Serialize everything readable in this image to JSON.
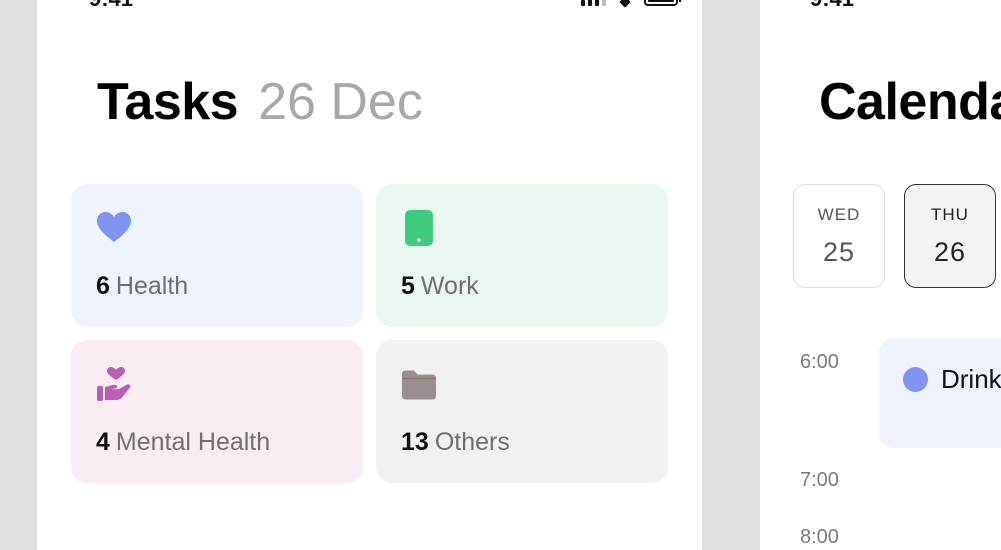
{
  "tasks_screen": {
    "status_time": "9:41",
    "title": "Tasks",
    "date": "26 Dec",
    "categories": [
      {
        "count": "6",
        "label": "Health",
        "icon": "heart-icon",
        "color": "#7f93f2"
      },
      {
        "count": "5",
        "label": "Work",
        "icon": "tablet-icon",
        "color": "#3ecb7f"
      },
      {
        "count": "4",
        "label": "Mental Health",
        "icon": "hand-heart-icon",
        "color": "#bc5fb4"
      },
      {
        "count": "13",
        "label": "Others",
        "icon": "folder-icon",
        "color": "#9a8f8e"
      }
    ]
  },
  "calendar_screen": {
    "status_time": "9:41",
    "title": "Calendar",
    "days": [
      {
        "name": "WED",
        "num": "25",
        "selected": false
      },
      {
        "name": "THU",
        "num": "26",
        "selected": true
      }
    ],
    "times": [
      "6:00",
      "7:00",
      "8:00"
    ],
    "event": {
      "title": "Drink",
      "color": "#7f93f2"
    }
  }
}
